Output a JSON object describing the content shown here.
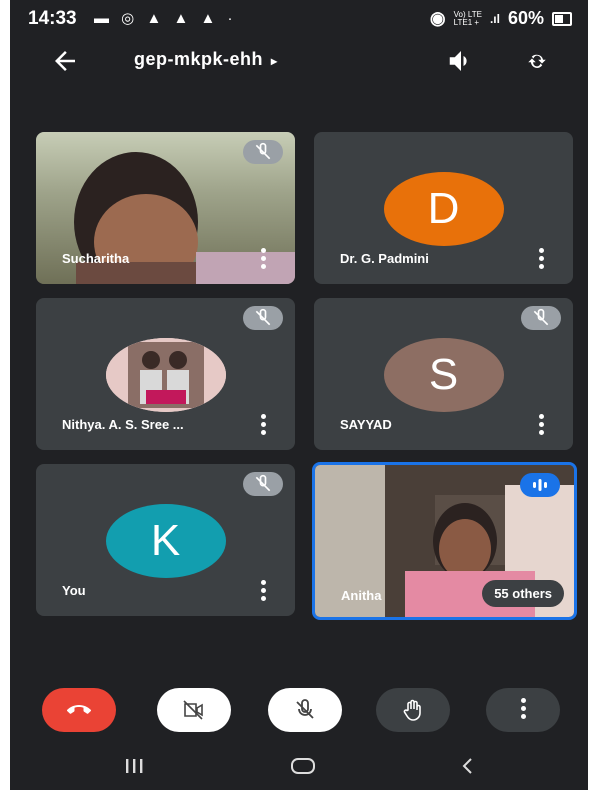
{
  "status_bar": {
    "time": "14:33",
    "notification_icons": [
      "chat-icon",
      "whatsapp-icon",
      "person-icon",
      "person-icon",
      "person-icon",
      "dot-icon"
    ],
    "network_label": "Vo) LTE LTE1 +",
    "battery": "60%"
  },
  "meeting": {
    "code": "gep-mkpk-ehh",
    "caret": "▸"
  },
  "tiles": [
    {
      "name": "Sucharitha",
      "type": "video",
      "muted": true
    },
    {
      "name": "Dr. G. Padmini",
      "type": "avatar",
      "initial": "D",
      "avatar_color": "#e8710a",
      "muted": false
    },
    {
      "name": "Nithya. A. S. Sree ...",
      "type": "photo",
      "muted": true
    },
    {
      "name": "SAYYAD",
      "type": "avatar",
      "initial": "S",
      "avatar_color": "#8d6e63",
      "muted": true
    },
    {
      "name": "You",
      "type": "avatar",
      "initial": "K",
      "avatar_color": "#129eaf",
      "muted": true
    },
    {
      "name": "Anitha",
      "type": "video",
      "speaking": true,
      "others": "55 others"
    }
  ],
  "controls": [
    {
      "name": "end-call",
      "icon": "phone-hangup-icon",
      "color": "#ea4335"
    },
    {
      "name": "camera-off",
      "icon": "video-off-icon",
      "color": "#ffffff"
    },
    {
      "name": "mic-off",
      "icon": "mic-off-icon",
      "color": "#ffffff"
    },
    {
      "name": "raise-hand",
      "icon": "hand-icon",
      "color": "#3c4043"
    },
    {
      "name": "more-options",
      "icon": "more-vert-icon",
      "color": "#3c4043"
    }
  ],
  "colors": {
    "background": "#202124",
    "tile": "#3c4043",
    "active_speaker_border": "#1a73e8"
  }
}
